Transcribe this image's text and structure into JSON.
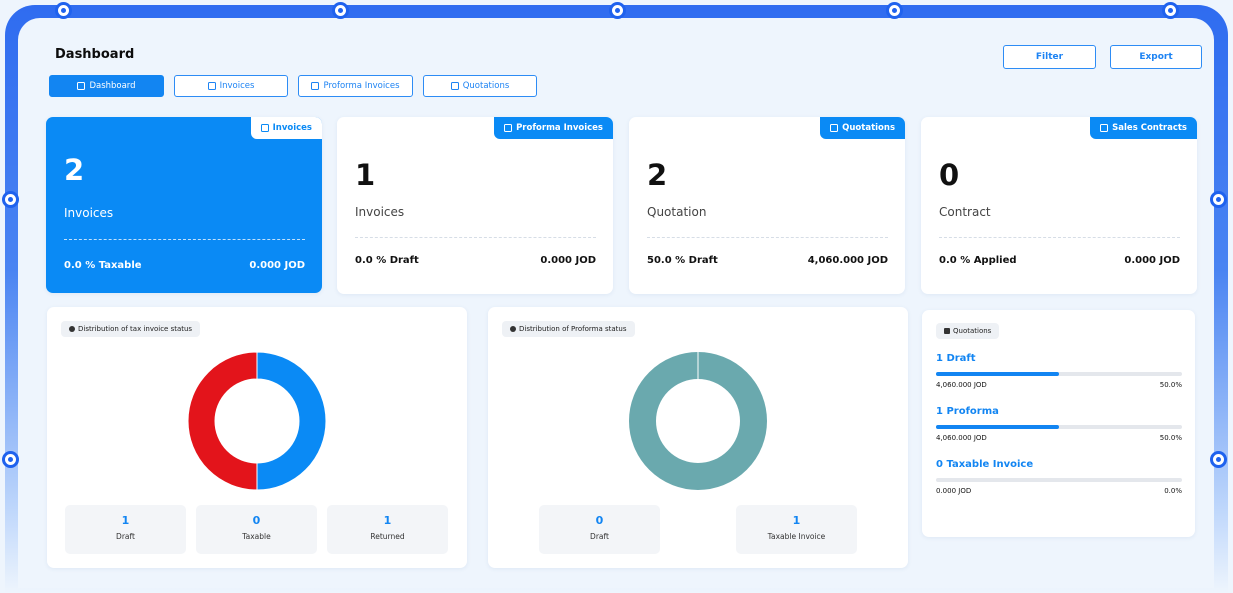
{
  "header": {
    "title": "Dashboard",
    "filter_label": "Filter",
    "export_label": "Export"
  },
  "tabs": [
    {
      "label": "Dashboard",
      "icon": "dashboard-icon"
    },
    {
      "label": "Invoices",
      "icon": "invoice-icon"
    },
    {
      "label": "Proforma Invoices",
      "icon": "proforma-icon"
    },
    {
      "label": "Quotations",
      "icon": "quotation-icon"
    }
  ],
  "cards": [
    {
      "tag": "Invoices",
      "count": "2",
      "label": "Invoices",
      "left_stat": "0.0 % Taxable",
      "right_stat": "0.000 JOD"
    },
    {
      "tag": "Proforma Invoices",
      "count": "1",
      "label": "Invoices",
      "left_stat": "0.0 % Draft",
      "right_stat": "0.000 JOD"
    },
    {
      "tag": "Quotations",
      "count": "2",
      "label": "Quotation",
      "left_stat": "50.0 % Draft",
      "right_stat": "4,060.000 JOD"
    },
    {
      "tag": "Sales Contracts",
      "count": "0",
      "label": "Contract",
      "left_stat": "0.0 % Applied",
      "right_stat": "0.000 JOD"
    }
  ],
  "tax_panel": {
    "chip": "Distribution of tax invoice status",
    "stats": [
      {
        "value": "1",
        "label": "Draft"
      },
      {
        "value": "0",
        "label": "Taxable"
      },
      {
        "value": "1",
        "label": "Returned"
      }
    ]
  },
  "proforma_panel": {
    "chip": "Distribution of Proforma status",
    "stats": [
      {
        "value": "0",
        "label": "Draft"
      },
      {
        "value": "1",
        "label": "Taxable Invoice"
      }
    ]
  },
  "quotations_panel": {
    "chip": "Quotations",
    "items": [
      {
        "name": "1 Draft",
        "amount": "4,060.000 JOD",
        "percent_text": "50.0%",
        "fill": 0.5
      },
      {
        "name": "1 Proforma",
        "amount": "4,060.000 JOD",
        "percent_text": "50.0%",
        "fill": 0.5
      },
      {
        "name": "0 Taxable Invoice",
        "amount": "0.000 JOD",
        "percent_text": "0.0%",
        "fill": 0.0
      }
    ]
  },
  "chart_data": [
    {
      "type": "pie",
      "categories": [
        "Draft",
        "Taxable",
        "Returned"
      ],
      "values": [
        1,
        0,
        1
      ],
      "colors": [
        "#0a8af5",
        "#f2b400",
        "#e3141b"
      ]
    },
    {
      "type": "pie",
      "categories": [
        "Draft",
        "Taxable Invoice"
      ],
      "values": [
        0,
        1
      ],
      "colors": [
        "#0a8af5",
        "#6aa9ae"
      ]
    }
  ]
}
